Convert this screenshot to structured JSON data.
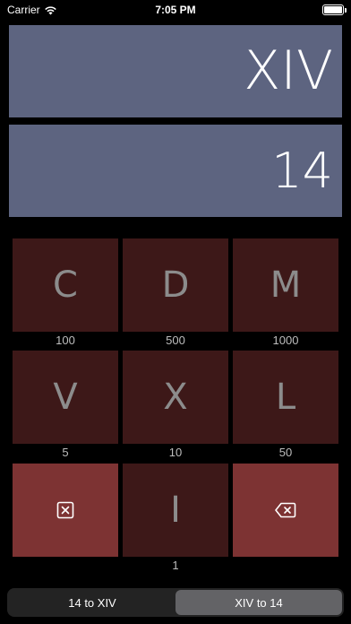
{
  "status": {
    "carrier": "Carrier",
    "time": "7:05 PM"
  },
  "display": {
    "roman": "XIV",
    "arabic": "14"
  },
  "keys": {
    "c": {
      "symbol": "C",
      "value": "100"
    },
    "d": {
      "symbol": "D",
      "value": "500"
    },
    "m": {
      "symbol": "M",
      "value": "1000"
    },
    "v": {
      "symbol": "V",
      "value": "5"
    },
    "x": {
      "symbol": "X",
      "value": "10"
    },
    "l": {
      "symbol": "L",
      "value": "50"
    },
    "i": {
      "symbol": "I",
      "value": "1"
    }
  },
  "icons": {
    "clear": "clear-box-x-icon",
    "backspace": "backspace-icon"
  },
  "segmented": {
    "left": "14 to XIV",
    "right": "XIV to 14",
    "selected": "right"
  },
  "colors": {
    "display": "#5d6480",
    "key": "#3d1818",
    "action_key": "#7d3333"
  }
}
